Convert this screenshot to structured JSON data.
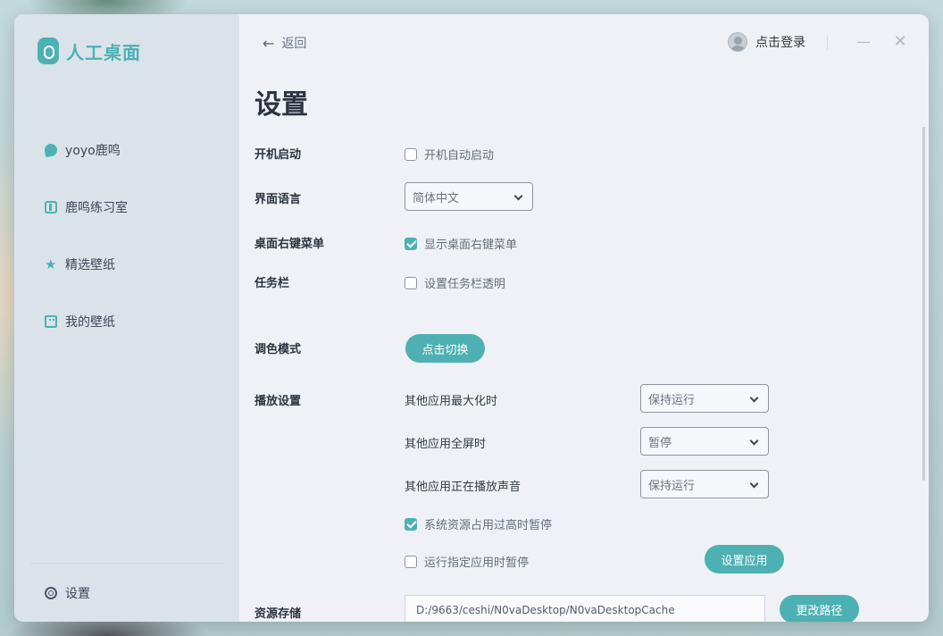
{
  "app": {
    "name": "人工桌面",
    "brand_color": "#4db1b3"
  },
  "sidebar": {
    "items": [
      {
        "label": "yoyo鹿鸣",
        "icon": "heart-icon"
      },
      {
        "label": "鹿鸣练习室",
        "icon": "book-icon"
      },
      {
        "label": "精选壁纸",
        "icon": "star-icon"
      },
      {
        "label": "我的壁纸",
        "icon": "monitor-icon"
      }
    ],
    "settings_label": "设置"
  },
  "header": {
    "back_label": "返回",
    "login_label": "点击登录"
  },
  "settings": {
    "title": "设置",
    "startup": {
      "label": "开机启动",
      "option": "开机自动启动",
      "checked": false
    },
    "language": {
      "label": "界面语言",
      "value": "简体中文"
    },
    "context_menu": {
      "label": "桌面右键菜单",
      "option": "显示桌面右键菜单",
      "checked": true
    },
    "taskbar": {
      "label": "任务栏",
      "option": "设置任务栏透明",
      "checked": false
    },
    "color_mode": {
      "label": "调色模式",
      "button": "点击切换"
    },
    "playback": {
      "label": "播放设置",
      "maximized": {
        "label": "其他应用最大化时",
        "value": "保持运行"
      },
      "fullscreen": {
        "label": "其他应用全屏时",
        "value": "暂停"
      },
      "sound": {
        "label": "其他应用正在播放声音",
        "value": "保持运行"
      },
      "high_resource": {
        "label": "系统资源占用过高时暂停",
        "checked": true
      },
      "specified_app": {
        "label": "运行指定应用时暂停",
        "checked": false,
        "button": "设置应用"
      }
    },
    "storage": {
      "label": "资源存储",
      "path": "D:/9663/ceshi/N0vaDesktop/N0vaDesktopCache",
      "button": "更改路径"
    }
  }
}
